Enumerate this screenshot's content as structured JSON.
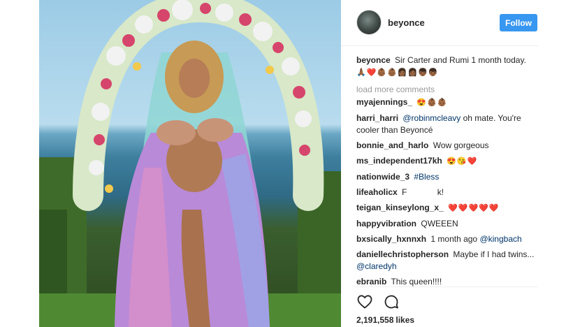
{
  "post": {
    "image_alt": "Beyoncé holding twins in front of a floral arch"
  },
  "header": {
    "username": "beyonce",
    "follow_label": "Follow",
    "follow_color": "#3897f0"
  },
  "caption": {
    "username": "beyonce",
    "text": "Sir Carter and Rumi 1 month today.",
    "emojis": "🙏🏾❤️👶🏾👶🏾👩🏾👩🏾👦🏾👦🏾"
  },
  "load_more": "load more comments",
  "comments": [
    {
      "username": "myajennings_",
      "text": "",
      "mention": "",
      "emojis": "😍👶🏾👶🏾"
    },
    {
      "username": "harri_harri",
      "mention": "@robinmcleavy",
      "text": "oh mate. You're cooler than Beyoncé",
      "emojis": ""
    },
    {
      "username": "bonnie_and_harlo",
      "mention": "",
      "text": "Wow gorgeous",
      "emojis": ""
    },
    {
      "username": "ms_independent17kh",
      "mention": "",
      "text": "",
      "emojis": "😍😘❤️"
    },
    {
      "username": "nationwide_3",
      "mention": "#Bless",
      "text": "",
      "emojis": ""
    },
    {
      "username": "lifeaholicx",
      "mention": "",
      "text": "F             k!",
      "emojis": ""
    },
    {
      "username": "teigan_kinseylong_x_",
      "mention": "",
      "text": "",
      "emojis": "❤️❤️❤️❤️❤️"
    },
    {
      "username": "happyvibration",
      "mention": "",
      "text": "QWEEEN",
      "emojis": ""
    },
    {
      "username": "bxsically_hxnnxh",
      "mention": "@kingbach",
      "text": "1 month ago",
      "emojis": ""
    },
    {
      "username": "daniellechristopherson",
      "mention": "@claredyh",
      "text": "Maybe if I had twins...",
      "emojis": ""
    },
    {
      "username": "ebranib",
      "mention": "",
      "text": "This queen!!!!",
      "emojis": ""
    }
  ],
  "actions": {
    "like_icon": "heart-icon",
    "comment_icon": "comment-icon"
  },
  "likes": {
    "count": "2,191,558",
    "label": "likes"
  }
}
